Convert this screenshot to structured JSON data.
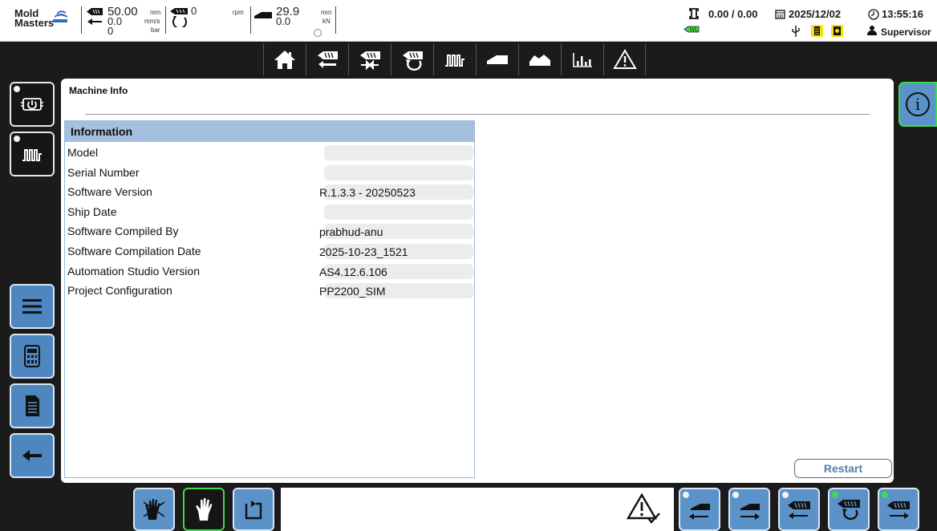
{
  "brand": {
    "line1": "Mold",
    "line2": "Masters"
  },
  "header": {
    "injection_pos": "50.00",
    "injection_pos_unit": "mm",
    "injection_speed": "0.0",
    "injection_speed_unit": "mm/s",
    "injection_pressure": "0",
    "injection_pressure_unit": "bar",
    "screw_rpm": "0",
    "screw_rpm_unit": "rpm",
    "clamp_pos": "29.9",
    "clamp_pos_unit": "mm",
    "clamp_force": "0.0",
    "clamp_force_unit": "kN",
    "cycle_values": "0.00 / 0.00",
    "date": "2025/12/02",
    "time": "13:55:16",
    "user": "Supervisor"
  },
  "nav": {
    "items": [
      "home-icon",
      "injection-icon",
      "hold-icon",
      "recovery-icon",
      "temperature-icon",
      "clamp-icon",
      "profile-icon",
      "statistics-icon",
      "alarm-icon"
    ]
  },
  "sidebar": {
    "left_top": [
      "power-icon",
      "heater-icon"
    ],
    "left_bottom": [
      "menu-icon",
      "calculator-icon",
      "document-icon",
      "back-icon"
    ]
  },
  "page": {
    "title": "Machine Info",
    "section_title": "Information",
    "restart_label": "Restart",
    "rows": [
      {
        "label": "Model",
        "value": ""
      },
      {
        "label": "Serial Number",
        "value": ""
      },
      {
        "label": "Software Version",
        "value": "R.1.3.3 - 20250523"
      },
      {
        "label": "Ship Date",
        "value": ""
      },
      {
        "label": "Software Compiled By",
        "value": "prabhud-anu"
      },
      {
        "label": "Software Compilation Date",
        "value": "2025-10-23_1521"
      },
      {
        "label": "Automation Studio Version",
        "value": "AS4.12.6.106"
      },
      {
        "label": "Project Configuration",
        "value": "PP2200_SIM"
      }
    ]
  },
  "bottom": {
    "mode_buttons": [
      "manual-gloves-icon",
      "manual-hand-icon",
      "cycle-icon"
    ],
    "motion_buttons": [
      "clamp-close-icon",
      "clamp-open-icon",
      "injection-back-icon",
      "screw-recovery-icon",
      "injection-forward-icon"
    ]
  },
  "colors": {
    "accent": "#5b92c8",
    "active": "#3ddc4a",
    "header_blue": "#a4c0de"
  }
}
